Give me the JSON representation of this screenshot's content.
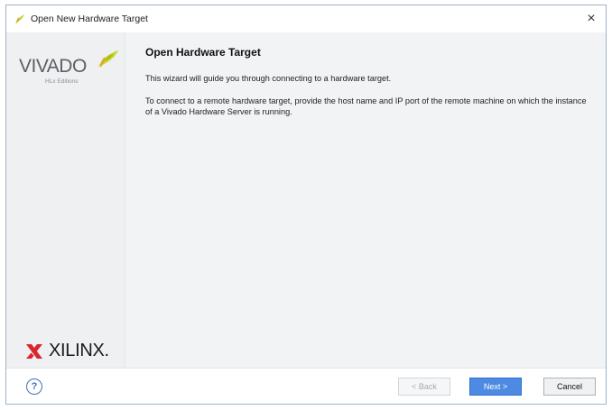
{
  "window": {
    "title": "Open New Hardware Target",
    "close_glyph": "×",
    "app_icon": "vivado-leaf-icon"
  },
  "sidebar": {
    "vivado_wordmark": "VIVADO",
    "vivado_edition": "HLx Editions",
    "xilinx_wordmark": "XILINX."
  },
  "main": {
    "title": "Open Hardware Target",
    "intro": "This wizard will guide you through connecting to a hardware target.",
    "instructions": "To connect to a remote hardware target, provide the host name and IP port of the remote machine on which the instance of a Vivado Hardware Server is running."
  },
  "footer": {
    "help_glyph": "?",
    "back_label": "< Back",
    "next_label": "Next >",
    "cancel_label": "Cancel"
  },
  "colors": {
    "accent": "#4d8be3",
    "sidebar_bg": "#eef0f2",
    "content_bg": "#f2f3f5",
    "vivado_leaf": "#c6d62b"
  }
}
